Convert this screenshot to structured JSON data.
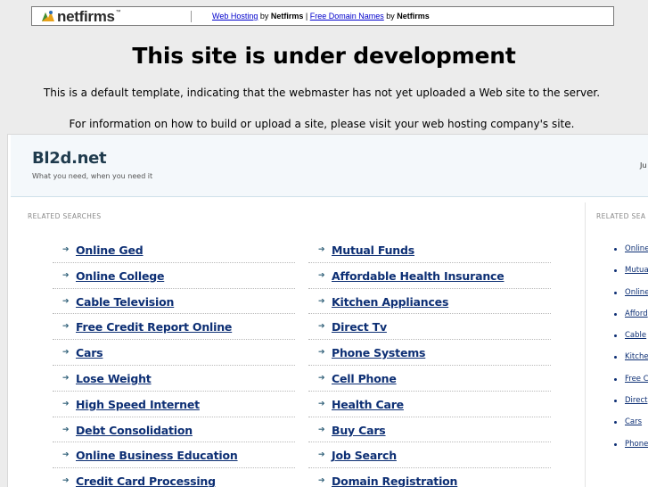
{
  "netfirms_bar": {
    "logo_text": "netfirms",
    "logo_icon": "netfirms-logo-icon",
    "web_hosting_link": "Web Hosting",
    "by1": " by ",
    "brand1": "Netfirms",
    "pipe": " | ",
    "free_domain_link": "Free Domain Names",
    "by2": " by ",
    "brand2": "Netfirms"
  },
  "headline": "This site is under development",
  "line1": "This is a default template, indicating that the webmaster has not yet uploaded a Web site to the server.",
  "line2": "For information on how to build or upload a site, please visit your web hosting company's site.",
  "parked": {
    "site_title": "Bl2d.net",
    "tagline": "What you need, when you need it",
    "header_right": "Ju",
    "related_label": "RELATED SEARCHES",
    "related_label_right": "RELATED SEA",
    "left_column": [
      "Online Ged",
      "Online College",
      "Cable Television",
      "Free Credit Report Online",
      "Cars",
      "Lose Weight",
      "High Speed Internet",
      "Debt Consolidation",
      "Online Business Education",
      "Credit Card Processing"
    ],
    "right_column": [
      "Mutual Funds",
      "Affordable Health Insurance",
      "Kitchen Appliances",
      "Direct Tv",
      "Phone Systems",
      "Cell Phone",
      "Health Care",
      "Buy Cars",
      "Job Search",
      "Domain Registration"
    ],
    "sidebar_links": [
      "Online",
      "Mutua",
      "Online",
      "Afford",
      "Cable",
      "Kitche",
      "Free C",
      "Direct",
      "Cars",
      "Phone"
    ],
    "arrow_icon": "arrow-right-icon",
    "accent_color": "#0d2f74"
  }
}
